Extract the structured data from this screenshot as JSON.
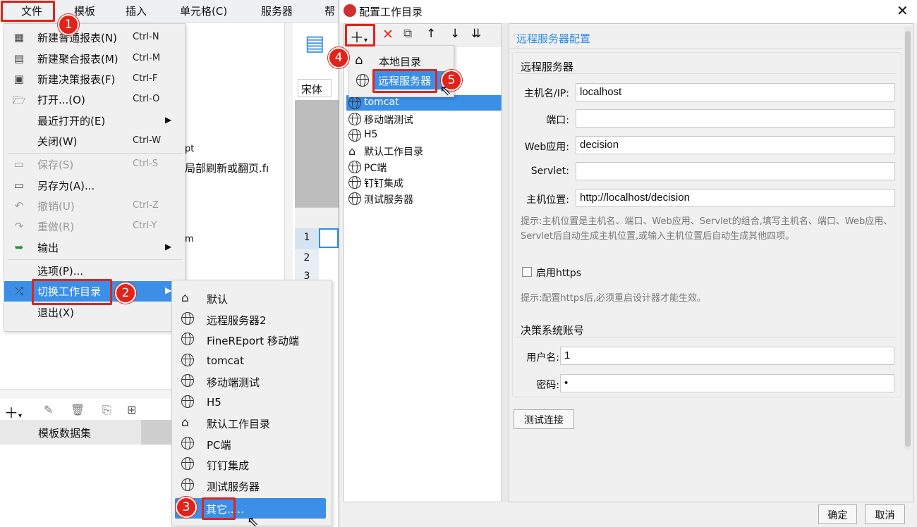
{
  "menubar": {
    "file": "文件",
    "template": "模板",
    "insert": "插入",
    "cell": "单元格(C)",
    "server": "服务器",
    "help": "帮"
  },
  "editor": {
    "font_name": "宋体",
    "text1": "pt",
    "text2": "局部刷新或翻页.fı",
    "text3": "m",
    "row_numbers": [
      "1",
      "2",
      "3"
    ]
  },
  "file_menu": {
    "items": [
      {
        "label": "新建普通报表(N)",
        "shortcut": "Ctrl-N",
        "icon": "grid-icon",
        "enabled": true
      },
      {
        "label": "新建聚合报表(M)",
        "shortcut": "Ctrl-M",
        "icon": "aggregate-icon",
        "enabled": true
      },
      {
        "label": "新建决策报表(F)",
        "shortcut": "Ctrl-F",
        "icon": "form-icon",
        "enabled": true
      },
      {
        "label": "打开...(O)",
        "shortcut": "Ctrl-O",
        "icon": "folder-icon",
        "enabled": true
      },
      {
        "label": "最近打开的(E)",
        "shortcut": "",
        "icon": "",
        "enabled": true
      },
      {
        "label": "关闭(W)",
        "shortcut": "Ctrl-W",
        "icon": "",
        "enabled": true
      },
      {
        "label": "保存(S)",
        "shortcut": "Ctrl-S",
        "icon": "save-icon",
        "enabled": false
      },
      {
        "label": "另存为(A)...",
        "shortcut": "",
        "icon": "save-as-icon",
        "enabled": true
      },
      {
        "label": "撤销(U)",
        "shortcut": "Ctrl-Z",
        "icon": "undo-icon",
        "enabled": false
      },
      {
        "label": "重做(R)",
        "shortcut": "Ctrl-Y",
        "icon": "redo-icon",
        "enabled": false
      },
      {
        "label": "输出",
        "shortcut": "",
        "icon": "export-icon",
        "enabled": true
      },
      {
        "label": "选项(P)...",
        "shortcut": "",
        "icon": "",
        "enabled": true
      },
      {
        "label": "切换工作目录",
        "shortcut": "",
        "icon": "shuffle-icon",
        "enabled": true
      },
      {
        "label": "退出(X)",
        "shortcut": "",
        "icon": "",
        "enabled": true
      }
    ]
  },
  "workdir_submenu": {
    "items": [
      "默认",
      "远程服务器2",
      "FineREport 移动端",
      "tomcat",
      "移动端测试",
      "H5",
      "默认工作目录",
      "PC端",
      "钉钉集成",
      "测试服务器",
      "其它....."
    ]
  },
  "bottom_panel": {
    "dataset_label": "模板数据集"
  },
  "dialog": {
    "title": "配置工作目录",
    "add_menu": {
      "local": "本地目录",
      "remote": "远程服务器"
    },
    "tree": [
      "tomcat",
      "移动端测试",
      "H5",
      "默认工作目录",
      "PC端",
      "钉钉集成",
      "测试服务器"
    ],
    "section_title": "远程服务器配置",
    "group_remote": "远程服务器",
    "fields": {
      "host_label": "主机名/IP:",
      "host_value": "localhost",
      "port_label": "端口:",
      "port_value": "",
      "webapp_label": "Web应用:",
      "webapp_value": "decision",
      "servlet_label": "Servlet:",
      "servlet_value": "",
      "location_label": "主机位置:",
      "location_value": "http://localhost/decision"
    },
    "hint1": "提示:主机位置是主机名、端口、Web应用、Servlet的组合,填写主机名、端口、Web应用、Servlet后自动生成主机位置,或输入主机位置后自动生成其他四项。",
    "https_label": "启用https",
    "hint2": "提示:配置https后,必须重启设计器才能生效。",
    "group_account": "决策系统账号",
    "username_label": "用户名:",
    "username_value": "1",
    "password_label": "密码:",
    "password_value": "•",
    "test_button": "测试连接",
    "ok_button": "确定",
    "cancel_button": "取消"
  },
  "badges": [
    "1",
    "2",
    "3",
    "4",
    "5"
  ],
  "colors": {
    "accent": "#2f8dea",
    "selection": "#3b8fe6",
    "callout": "#e2231a"
  }
}
